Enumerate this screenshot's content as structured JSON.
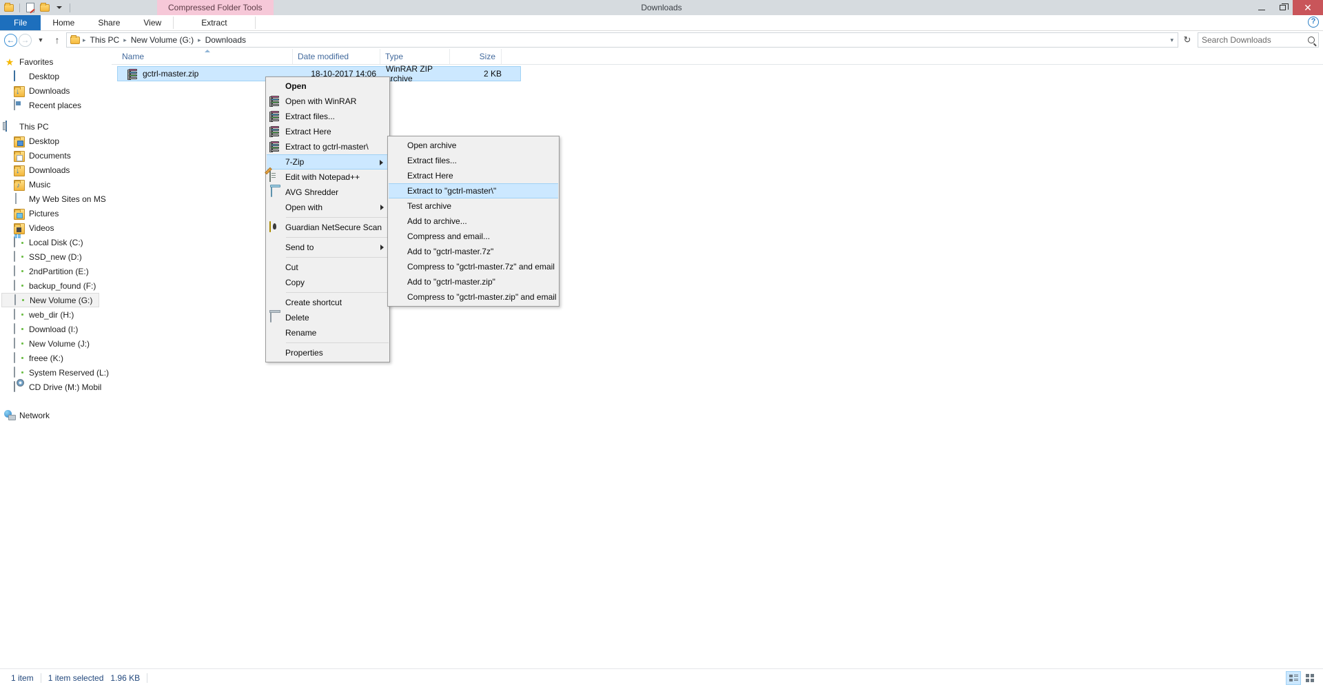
{
  "window": {
    "title": "Downloads",
    "contextual_tab_group": "Compressed Folder Tools",
    "minimize_label": "Minimize",
    "maximize_label": "Restore",
    "close_label": "Close"
  },
  "ribbon": {
    "tabs": [
      {
        "label": "File",
        "active": true
      },
      {
        "label": "Home"
      },
      {
        "label": "Share"
      },
      {
        "label": "View"
      },
      {
        "label": "Extract"
      }
    ],
    "help_label": "?"
  },
  "address": {
    "back_label": "Back",
    "forward_label": "Forward",
    "recent_label": "Recent locations",
    "up_label": "Up",
    "breadcrumbs": [
      "This PC",
      "New Volume (G:)",
      "Downloads"
    ],
    "separator": "▸",
    "refresh_label": "↻",
    "dropdown_label": "▾"
  },
  "search": {
    "placeholder": "Search Downloads",
    "value": "Search Downloads"
  },
  "sidebar": {
    "groups": [
      {
        "header": {
          "label": "Favorites",
          "icon": "star-icon"
        },
        "items": [
          {
            "label": "Desktop",
            "icon": "monitor-icon"
          },
          {
            "label": "Downloads",
            "icon": "folder-download-icon"
          },
          {
            "label": "Recent places",
            "icon": "recent-places-icon"
          }
        ]
      },
      {
        "header": {
          "label": "This PC",
          "icon": "computer-icon"
        },
        "items": [
          {
            "label": "Desktop",
            "icon": "folder-desktop-icon"
          },
          {
            "label": "Documents",
            "icon": "folder-documents-icon"
          },
          {
            "label": "Downloads",
            "icon": "folder-download-icon"
          },
          {
            "label": "Music",
            "icon": "folder-music-icon"
          },
          {
            "label": "My Web Sites on MS",
            "icon": "blank-document-icon"
          },
          {
            "label": "Pictures",
            "icon": "folder-pictures-icon"
          },
          {
            "label": "Videos",
            "icon": "folder-videos-icon"
          },
          {
            "label": "Local Disk (C:)",
            "icon": "system-drive-icon"
          },
          {
            "label": "SSD_new (D:)",
            "icon": "drive-icon"
          },
          {
            "label": "2ndPartition (E:)",
            "icon": "drive-icon"
          },
          {
            "label": "backup_found (F:)",
            "icon": "drive-icon"
          },
          {
            "label": "New Volume (G:)",
            "icon": "drive-icon",
            "selected": true
          },
          {
            "label": "web_dir (H:)",
            "icon": "drive-icon"
          },
          {
            "label": "Download (I:)",
            "icon": "drive-icon"
          },
          {
            "label": "New Volume (J:)",
            "icon": "drive-icon"
          },
          {
            "label": "freee (K:)",
            "icon": "drive-icon"
          },
          {
            "label": "System Reserved (L:)",
            "icon": "drive-icon"
          },
          {
            "label": "CD Drive (M:) Mobil",
            "icon": "cd-drive-icon"
          }
        ]
      },
      {
        "header": {
          "label": "Network",
          "icon": "network-icon"
        },
        "items": []
      }
    ]
  },
  "filelist": {
    "columns": [
      {
        "label": "Name",
        "sorted": true
      },
      {
        "label": "Date modified"
      },
      {
        "label": "Type"
      },
      {
        "label": "Size"
      }
    ],
    "rows": [
      {
        "name": "gctrl-master.zip",
        "date_modified": "18-10-2017 14:06",
        "type": "WinRAR ZIP archive",
        "size": "2 KB",
        "icon": "winrar-archive-icon",
        "selected": true
      }
    ]
  },
  "context_menu": {
    "items": [
      {
        "label": "Open",
        "bold": true,
        "icon": null
      },
      {
        "label": "Open with WinRAR",
        "icon": "winrar-icon"
      },
      {
        "label": "Extract files...",
        "icon": "winrar-icon"
      },
      {
        "label": "Extract Here",
        "icon": "winrar-icon"
      },
      {
        "label": "Extract to gctrl-master\\",
        "icon": "winrar-icon"
      },
      {
        "label": "7-Zip",
        "icon": null,
        "submenu": true,
        "highlighted": true
      },
      {
        "label": "Edit with Notepad++",
        "icon": "notepadpp-icon"
      },
      {
        "label": "AVG Shredder",
        "icon": "avg-shredder-icon"
      },
      {
        "label": "Open with",
        "icon": null,
        "submenu": true
      },
      {
        "separator": true
      },
      {
        "label": "Guardian NetSecure Scan",
        "icon": "guardian-icon"
      },
      {
        "separator": true
      },
      {
        "label": "Send to",
        "icon": null,
        "submenu": true
      },
      {
        "separator": true
      },
      {
        "label": "Cut",
        "icon": null
      },
      {
        "label": "Copy",
        "icon": null
      },
      {
        "separator": true
      },
      {
        "label": "Create shortcut",
        "icon": null
      },
      {
        "label": "Delete",
        "icon": null
      },
      {
        "label": "Rename",
        "icon": null
      },
      {
        "separator": true
      },
      {
        "label": "Properties",
        "icon": null
      }
    ]
  },
  "submenu_7zip": {
    "parent": "7-Zip",
    "items": [
      {
        "label": "Open archive"
      },
      {
        "label": "Extract files..."
      },
      {
        "label": "Extract Here"
      },
      {
        "label": "Extract to \"gctrl-master\\\"",
        "highlighted": true
      },
      {
        "label": "Test archive"
      },
      {
        "label": "Add to archive..."
      },
      {
        "label": "Compress and email..."
      },
      {
        "label": "Add to \"gctrl-master.7z\""
      },
      {
        "label": "Compress to \"gctrl-master.7z\" and email"
      },
      {
        "label": "Add to \"gctrl-master.zip\""
      },
      {
        "label": "Compress to \"gctrl-master.zip\" and email"
      }
    ]
  },
  "statusbar": {
    "item_count": "1 item",
    "selection": "1 item selected",
    "selection_size": "1.96 KB",
    "details_view_label": "Details view",
    "large_icons_view_label": "Large icons view"
  },
  "colors": {
    "titlebar": "#d6dbdf",
    "file_tab": "#1d6fbd",
    "contextual_tab": "#f6c8d8",
    "selection": "#cce8ff",
    "selection_border": "#9fd1f5",
    "close_button": "#c9555a",
    "column_header_text": "#41699c",
    "status_text": "#21477c"
  }
}
